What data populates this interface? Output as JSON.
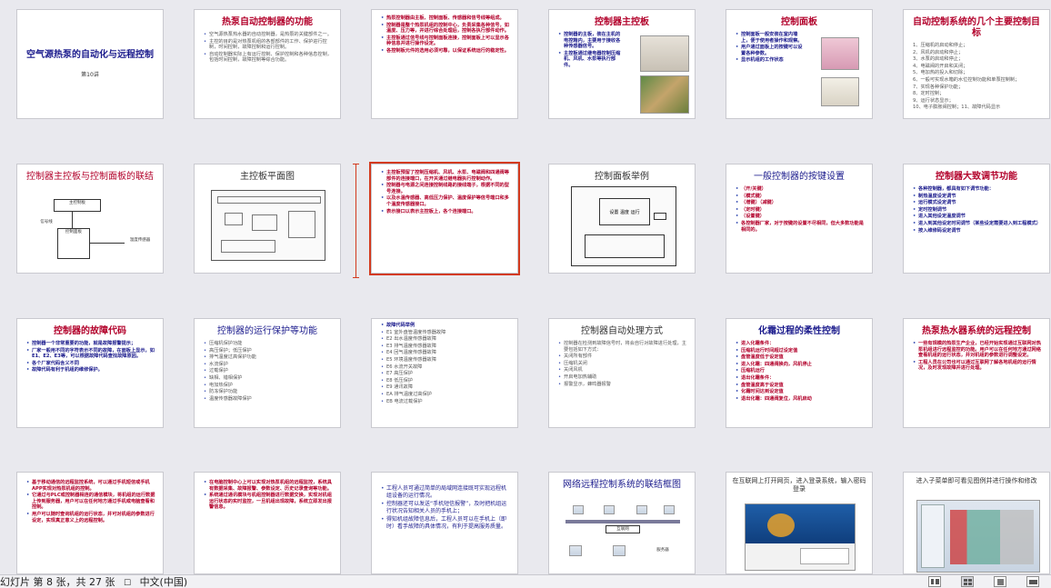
{
  "slides": [
    {
      "title": "空气源热泵的自动化与远程控制",
      "subtitle": "第10讲"
    },
    {
      "title": "热泵自动控制器的功能",
      "bullets": [
        "空气源热泵热水器的自动控制器，是热泵的关键部件之一。",
        "主控的目的是对热泵机组的各部部件的工作、保护进行控制，时间控制，故障控制和运行控制。",
        "自动控制器实际上有运行控制、保护控制和各种信息控制，包括时间控制，故障控制等综合功能。"
      ]
    },
    {
      "title": "",
      "bullets": [
        "热泵控制器由主板、控制面板、传感器和信号线等组成。",
        "控制器是整个热泵机组的控制中心，负责采集各种信号，如温度、压力等，并进行综合处理后，控制各执行部件动作。",
        "主控板通过信号线与控制面板连接，控制面板上可以显示各种信息并进行操作设定。",
        "各控制板元件的选用必须可靠，以保证系统运行的稳定性。"
      ]
    },
    {
      "title": "控制器主控板",
      "bullets": [
        "控制器的主板，装在主机的电控箱内，主要用于接收各种传感器信号。",
        "主控板通过继电器控制压缩机、风机、水泵等执行部件。"
      ]
    },
    {
      "title": "控制面板",
      "bullets": [
        "控制面板一般安装在室内墙上，便于使用者操作和观察。",
        "用户通过面板上的按键可以设置各种参数。",
        "显示机组的工作状态"
      ]
    },
    {
      "title": "自动控制系统的几个主要控制目标",
      "bullets": [
        "1、压缩机的启动和停止；",
        "2、风机的启动和停止；",
        "3、水泵的启动和停止；",
        "4、电磁阀的开启和关闭；",
        "5、电加热的投入和切除；",
        "6、一般可实现水箱的水位控制功能和单泵控制制；",
        "7、实现各种保护功能；",
        "8、定时控制；",
        "9、运行状态显示；",
        "10、电子膨胀阀控制；11、故障代码显示"
      ]
    },
    {
      "title": "控制器主控板与控制面板的联结",
      "labels": [
        "主控制板",
        "控制面板",
        "信号线",
        "温度传感器"
      ]
    },
    {
      "title": "主控板平面图"
    },
    {
      "title": "",
      "bullets": [
        "主控板预留了控制压缩机、风机、水泵、电磁阀和四通阀等部件的连接端口，在开关通过继电器执行控制动作。",
        "控制器与电源之间连接控制线路的接线端子，根据不同的型号连接。",
        "以及水温传感器、高低压力保护、温度保护等信号端口和多个温度传感器接口。",
        "表示接口以表示主控板上，各个连接端口。"
      ]
    },
    {
      "title": "控制面板举例",
      "screen_text": "设置 温度 运行"
    },
    {
      "title": "一般控制器的按键设置",
      "bullets": [
        "（开/关键）",
        "（模式键）",
        "（增键）（减键）",
        "（定时键）",
        "（设置键）",
        "各控制器厂家，对于按键的设置不尽相同，但大多数功能是相同的。"
      ]
    },
    {
      "title": "控制器大致调节功能",
      "bullets": [
        "各种控制器，都具有如下调节功能：",
        "制热温度设定调节",
        "运行模式设定调节",
        "定时控制调节",
        "进入其他设定温度调节",
        "进入到其他设定时间调节（某些设定需要进入到工程模式）",
        "按入维修码设定调节"
      ]
    },
    {
      "title": "控制器的故障代码",
      "bullets": [
        "控制器一个非常重要的功能，就是故障报警提示；",
        "厂家一般用不同的字符表示不同的故障，在面板上显示，如E1、E2、E3等，可以根据故障代码查找故障原因。",
        "各个厂家代码含义不同",
        "故障代码有利于机组的维修保护。"
      ]
    },
    {
      "title": "控制器的运行保护等功能",
      "bullets": [
        "压缩机保护功能",
        "高压保护；低压保护",
        "排气温度过高保护功能",
        "水流保护",
        "过载保护",
        "缺相、错相保护",
        "电加热保护",
        "防冻保护功能",
        "温度传感器故障保护"
      ]
    },
    {
      "title": "",
      "bullets": [
        "故障代码举例",
        "E1 室外盘管温度传感器故障",
        "E2 出水温度传感器故障",
        "E3 排气温度传感器故障",
        "E4 回气温度传感器故障",
        "E5 环境温度传感器故障",
        "E6 水流开关故障",
        "E7 高压保护",
        "E8 低压保护",
        "E9 通讯故障",
        "EA 排气温度过高保护",
        "EB 电流过载保护"
      ]
    },
    {
      "title": "控制器自动处理方式",
      "bullets": [
        "控制器在检测到故障信号时，将会自行对故障进行处理，主要包括如下方式：",
        "关闭所有部件",
        "压缩机关闭",
        "关闭风机",
        "开启电加热辅助",
        "报警显示，蜂鸣器报警"
      ]
    },
    {
      "title": "化霜过程的柔性控制",
      "bullets": [
        "进入化霜条件：",
        "压缩机运行时间超过设定值",
        "盘管温度低于设定值",
        "进入化霜：四通阀换向，风机停止",
        "压缩机运行",
        "退出化霜条件：",
        "盘管温度高于设定值",
        "化霜时间达到设定值",
        "退出化霜：四通阀复位，风机启动"
      ]
    },
    {
      "title": "热泵热水器系统的远程控制",
      "bullets": [
        "一些有规模的热泵生产企业，已经开始实现通过互联网对热泵机组进行远程监控的功能。用户可以在任何地方通过网络查看机组的运行状态，并对机组的参数进行调整设定。",
        "工程人员在公司也可以通过互联网了解各地机组的运行情况，及时发现故障并进行处理。"
      ]
    },
    {
      "title": "",
      "bullets": [
        "基于移动通信的远程监控系统，可以通过手机短信或手机APP实现对热泵机组的控制。",
        "它通过与PLC或控制器相连的通信模块，将机组的运行数据上传到服务器，用户可以在任何地方通过手机或电脑查看和控制。",
        "用户可以随时查询机组的运行状态，并可对机组的参数进行设定，实现真正意义上的远程控制。"
      ]
    },
    {
      "title": "",
      "bullets": [
        "在电脑控制中心上可以实现对热泵机组的远程监控，系统具有数据采集、故障报警、参数设定、历史记录查询等功能。",
        "系统通过通讯模块与机组控制器进行数据交换，实现对机组运行状态的实时监控，一旦机组出现故障，系统立即发出报警信息。"
      ]
    },
    {
      "title": "",
      "bullets": [
        "工程人员可通过简单的局域网连接既可实现远程机组设备的运行情况。",
        "控制器还可以发送“手机短信报警”，及时把机组运行状况告知相关人员的手机上；",
        "得知机组故障信息后，工程人员可以在手机上（即时）看手故障的具体情况，有利于提高服务质量。"
      ]
    },
    {
      "title": "网络远程控制系统的联结框图",
      "labels": [
        "互联网",
        "服务器"
      ]
    },
    {
      "title": "在互联网上打开网页，进入登录系统，输入密码登录"
    },
    {
      "title": "进入子菜单即可看见图例并进行操作和修改"
    }
  ],
  "status": {
    "slide_label": "幻灯片 第 8 张，共 27 张",
    "language": "中文(中国)"
  },
  "colors": {
    "red_title": "#b2002a",
    "blue_title": "#1a1a8c",
    "selection": "#d33a1e"
  }
}
